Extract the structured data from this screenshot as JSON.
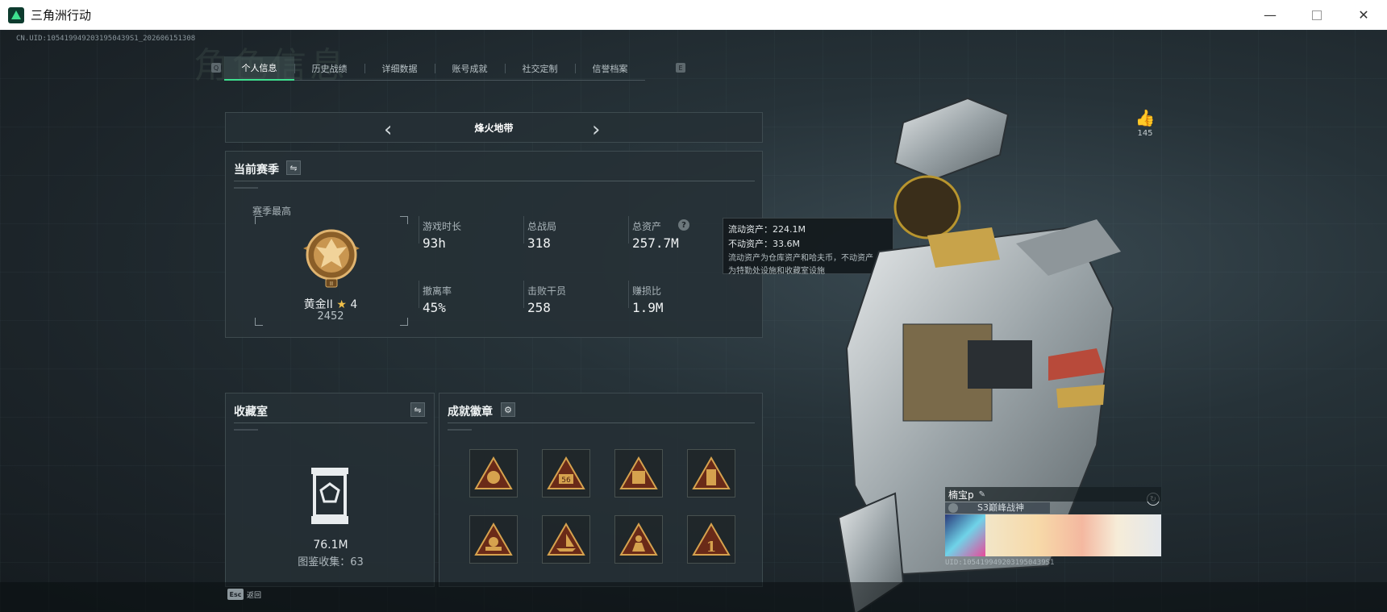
{
  "window": {
    "title": "三角洲行动",
    "minimize": "—",
    "maximize": "",
    "close": "✕"
  },
  "header": {
    "uid": "CN.UID:1054199492031950439S1_202606151308",
    "bg_title": "角色信息"
  },
  "tabs": [
    {
      "label": "个人信息",
      "active": true
    },
    {
      "label": "历史战绩",
      "active": false
    },
    {
      "label": "详细数据",
      "active": false
    },
    {
      "label": "账号成就",
      "active": false
    },
    {
      "label": "社交定制",
      "active": false
    },
    {
      "label": "信誉档案",
      "active": false
    }
  ],
  "tab_keys": {
    "left": "Q",
    "right": "E"
  },
  "mode": {
    "name": "烽火地带",
    "prev": "‹",
    "next": "›"
  },
  "season": {
    "title": "当前赛季",
    "switch_icon": "swap-icon",
    "best_label": "赛季最高",
    "rank_name": "黄金II",
    "rank_stars": "4",
    "rank_score": "2452",
    "stats": [
      {
        "label": "游戏时长",
        "value": "93h"
      },
      {
        "label": "总战局",
        "value": "318"
      },
      {
        "label": "总资产",
        "value": "257.7M"
      },
      {
        "label": "撤离率",
        "value": "45%"
      },
      {
        "label": "击败干员",
        "value": "258"
      },
      {
        "label": "赚损比",
        "value": "1.9M"
      }
    ]
  },
  "tooltip": {
    "liquid": "流动资产：224.1M",
    "fixed": "不动资产：33.6M",
    "note_line1": "流动资产为仓库资产和哈夫币，不动资产",
    "note_line2": "为特勤处设施和收藏室设施"
  },
  "collection": {
    "title": "收藏室",
    "value": "76.1M",
    "count_label": "图鉴收集：63"
  },
  "badges": {
    "title": "成就徽章",
    "settings_icon": "gear-icon",
    "items": [
      {
        "icon": "badge-eagle-icon",
        "text": ""
      },
      {
        "icon": "badge-56-icon",
        "text": "56"
      },
      {
        "icon": "badge-shield-icon",
        "text": ""
      },
      {
        "icon": "badge-tower-icon",
        "text": ""
      },
      {
        "icon": "badge-crest-icon",
        "text": ""
      },
      {
        "icon": "badge-ship-icon",
        "text": ""
      },
      {
        "icon": "badge-soldier-icon",
        "text": ""
      },
      {
        "icon": "badge-1-icon",
        "text": "1"
      }
    ]
  },
  "likes": {
    "count": "145"
  },
  "profile": {
    "name": "楠宝p",
    "title": "S3巅峰战神",
    "uid": "UID:1054199492031950439S1"
  },
  "footer": {
    "esc_key": "Esc",
    "esc_label": "返回"
  },
  "colors": {
    "accent": "#3ee08f",
    "gold": "#c89a4e",
    "panel": "#263036"
  }
}
